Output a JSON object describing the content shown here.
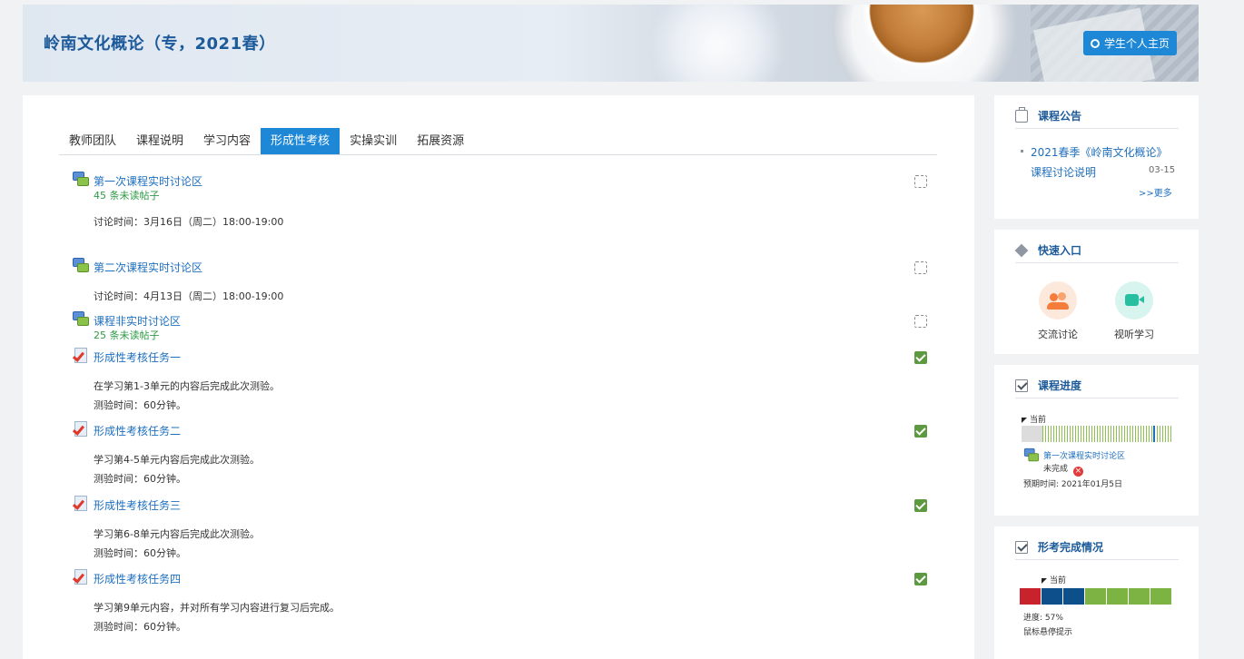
{
  "header": {
    "course_title": "岭南文化概论（专，2021春）",
    "home_button": "学生个人主页"
  },
  "tabs": [
    {
      "label": "教师团队",
      "active": false
    },
    {
      "label": "课程说明",
      "active": false
    },
    {
      "label": "学习内容",
      "active": false
    },
    {
      "label": "形成性考核",
      "active": true
    },
    {
      "label": "实操实训",
      "active": false
    },
    {
      "label": "拓展资源",
      "active": false
    }
  ],
  "activities": [
    {
      "type": "forum",
      "title": "第一次课程实时讨论区",
      "sub": "45 条未读帖子",
      "desc": [
        "讨论时间：3月16日（周二）18:00-19:00"
      ],
      "completed": false
    },
    {
      "type": "forum",
      "title": "第二次课程实时讨论区",
      "sub": "",
      "desc": [
        "讨论时间：4月13日（周二）18:00-19:00"
      ],
      "completed": false
    },
    {
      "type": "forum",
      "title": "课程非实时讨论区",
      "sub": "25 条未读帖子",
      "desc": [],
      "completed": false
    },
    {
      "type": "quiz",
      "title": "形成性考核任务一",
      "sub": "",
      "desc": [
        "在学习第1-3单元的内容后完成此次测验。",
        "测验时间：60分钟。"
      ],
      "completed": true
    },
    {
      "type": "quiz",
      "title": "形成性考核任务二",
      "sub": "",
      "desc": [
        "学习第4-5单元内容后完成此次测验。",
        "测验时间：60分钟。"
      ],
      "completed": true
    },
    {
      "type": "quiz",
      "title": "形成性考核任务三",
      "sub": "",
      "desc": [
        "学习第6-8单元内容后完成此次测验。",
        "测验时间：60分钟。"
      ],
      "completed": true
    },
    {
      "type": "quiz",
      "title": "形成性考核任务四",
      "sub": "",
      "desc": [
        "学习第9单元内容，并对所有学习内容进行复习后完成。",
        "测验时间：60分钟。"
      ],
      "completed": true
    }
  ],
  "announcements": {
    "title": "课程公告",
    "items": [
      {
        "line1": "2021春季《岭南文化概论》",
        "line2": "课程讨论说明",
        "date": "03-15"
      }
    ],
    "more": ">>更多"
  },
  "quick": {
    "title": "快速入口",
    "items": [
      {
        "label": "交流讨论",
        "icon": "people-icon",
        "color": "#f47d3c"
      },
      {
        "label": "视听学习",
        "icon": "video-camera-icon",
        "color": "#26bfa2"
      }
    ]
  },
  "progress": {
    "title": "课程进度",
    "current": "当前",
    "item_title": "第一次课程实时讨论区",
    "status": "未完成",
    "expected": "预期时间: 2021年01月5日"
  },
  "completion": {
    "title": "形考完成情况",
    "current": "当前",
    "segments": [
      "#c8232c",
      "#0d4f8b",
      "#0d4f8b",
      "#7cb342",
      "#7cb342",
      "#7cb342",
      "#7cb342"
    ],
    "progress_text": "进度: 57%",
    "hint": "鼠标悬停提示"
  }
}
